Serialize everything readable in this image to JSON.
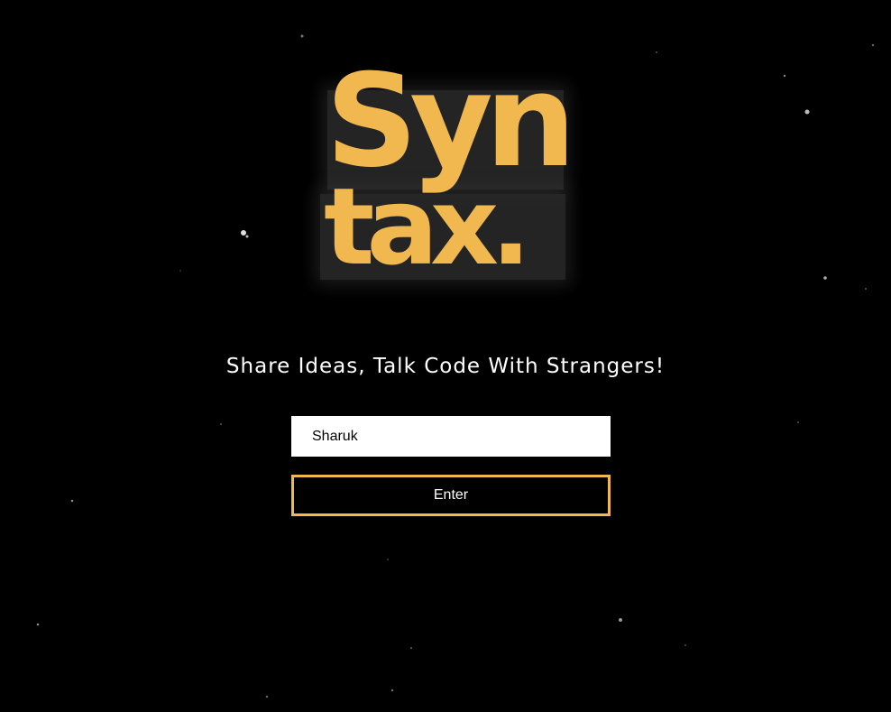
{
  "colors": {
    "background": "#000000",
    "accent": "#f0b84e",
    "text": "#ffffff",
    "input_bg": "#ffffff"
  },
  "logo": {
    "line1": "Syn",
    "line2": "tax."
  },
  "tagline": "Share Ideas, Talk Code With Strangers!",
  "form": {
    "name_value": "Sharuk",
    "enter_label": "Enter"
  },
  "icons": [
    "star-speck"
  ]
}
